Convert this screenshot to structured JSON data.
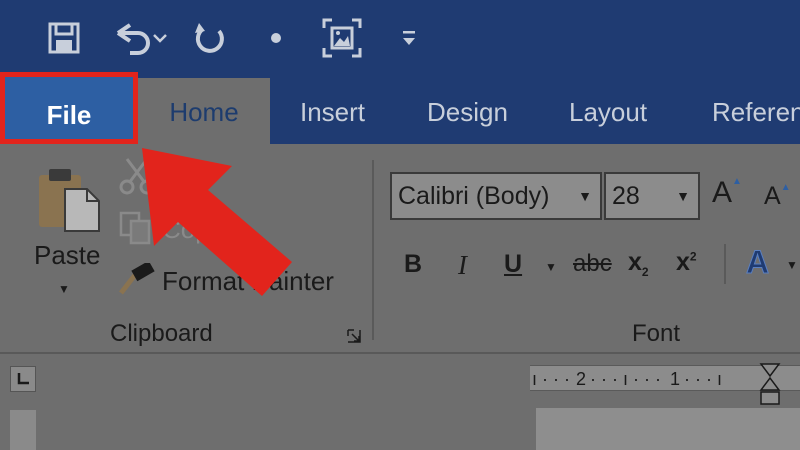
{
  "quick_access": {
    "icons": [
      "save-icon",
      "undo-icon",
      "redo-icon",
      "dot-icon",
      "select-frame-icon",
      "customize-icon"
    ]
  },
  "tabs": {
    "file": "File",
    "home": "Home",
    "insert": "Insert",
    "design": "Design",
    "layout": "Layout",
    "references": "Referen"
  },
  "clipboard": {
    "paste": "Paste",
    "cut_icon": "scissors-icon",
    "copy": "Copy",
    "format_painter": "Format Painter",
    "group_label": "Clipboard"
  },
  "font": {
    "font_name": "Calibri (Body)",
    "font_size": "28",
    "grow": "A",
    "shrink": "A",
    "bold": "B",
    "italic": "I",
    "underline": "U",
    "strikethrough": "abc",
    "subscript": "x",
    "subscript_mark": "2",
    "superscript": "x",
    "superscript_mark": "2",
    "text_effects": "A",
    "group_label": "Font"
  },
  "ruler": {
    "labels": [
      "2",
      "1"
    ]
  },
  "colors": {
    "title_bar": "#1f3b72",
    "file_tab": "#2d5fa3",
    "highlight": "#e2241c"
  }
}
